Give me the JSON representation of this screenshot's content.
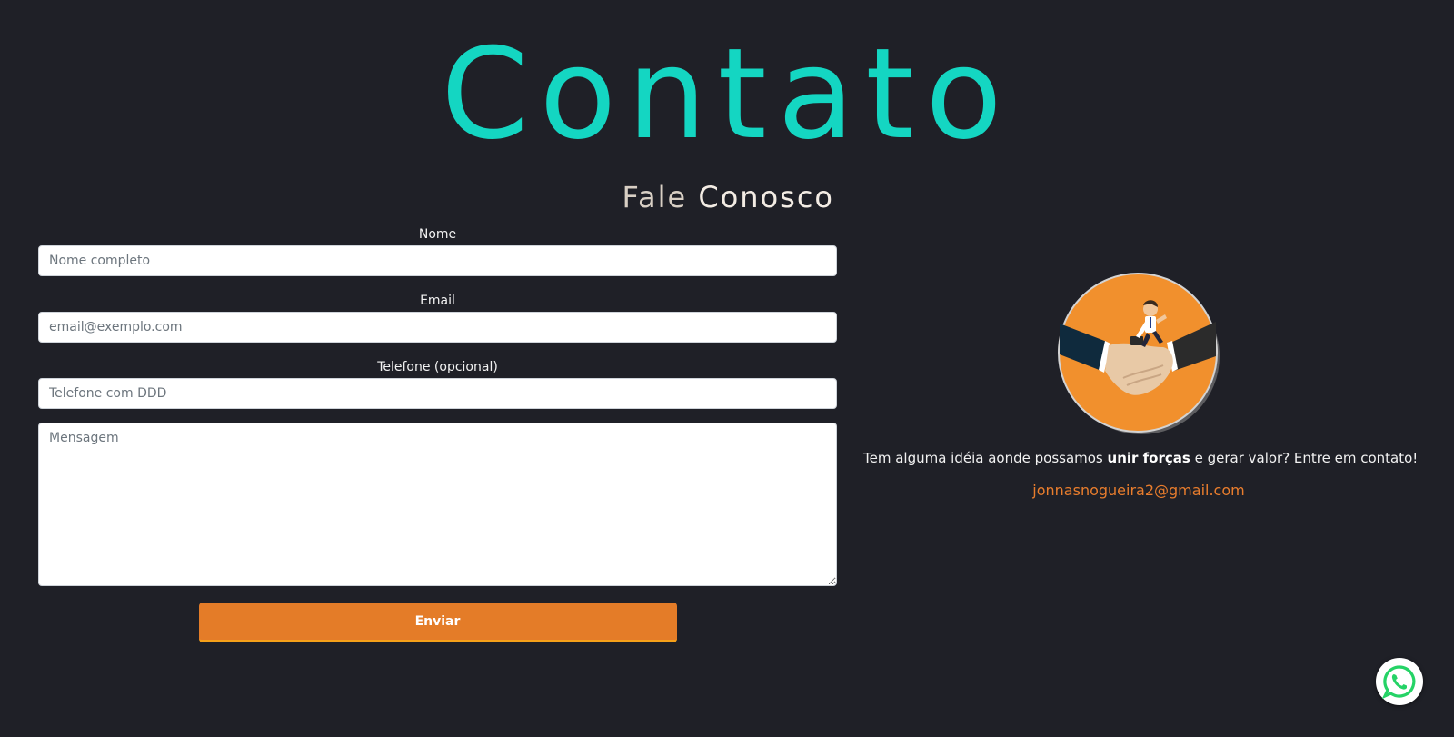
{
  "colors": {
    "background": "#1f2027",
    "title": "#14d6c2",
    "accent_orange": "#e47c28",
    "email_link": "#e97d2d",
    "whatsapp_green": "#25d366"
  },
  "header": {
    "title": "Contato",
    "subtitle_thin": "Fale",
    "subtitle_strong": "Conosco"
  },
  "form": {
    "name_label": "Nome",
    "name_placeholder": "Nome completo",
    "email_label": "Email",
    "email_placeholder": "email@exemplo.com",
    "phone_label": "Telefone (opcional)",
    "phone_placeholder": "Telefone com DDD",
    "message_placeholder": "Mensagem",
    "submit_label": "Enviar"
  },
  "contact": {
    "image_icon": "handshake-illustration-icon",
    "text_before": "Tem alguma idéia aonde possamos ",
    "text_bold": "unir forças",
    "text_after": " e gerar valor? Entre em contato!",
    "email": "jonnasnogueira2@gmail.com"
  },
  "floating": {
    "whatsapp_icon": "whatsapp-icon"
  }
}
